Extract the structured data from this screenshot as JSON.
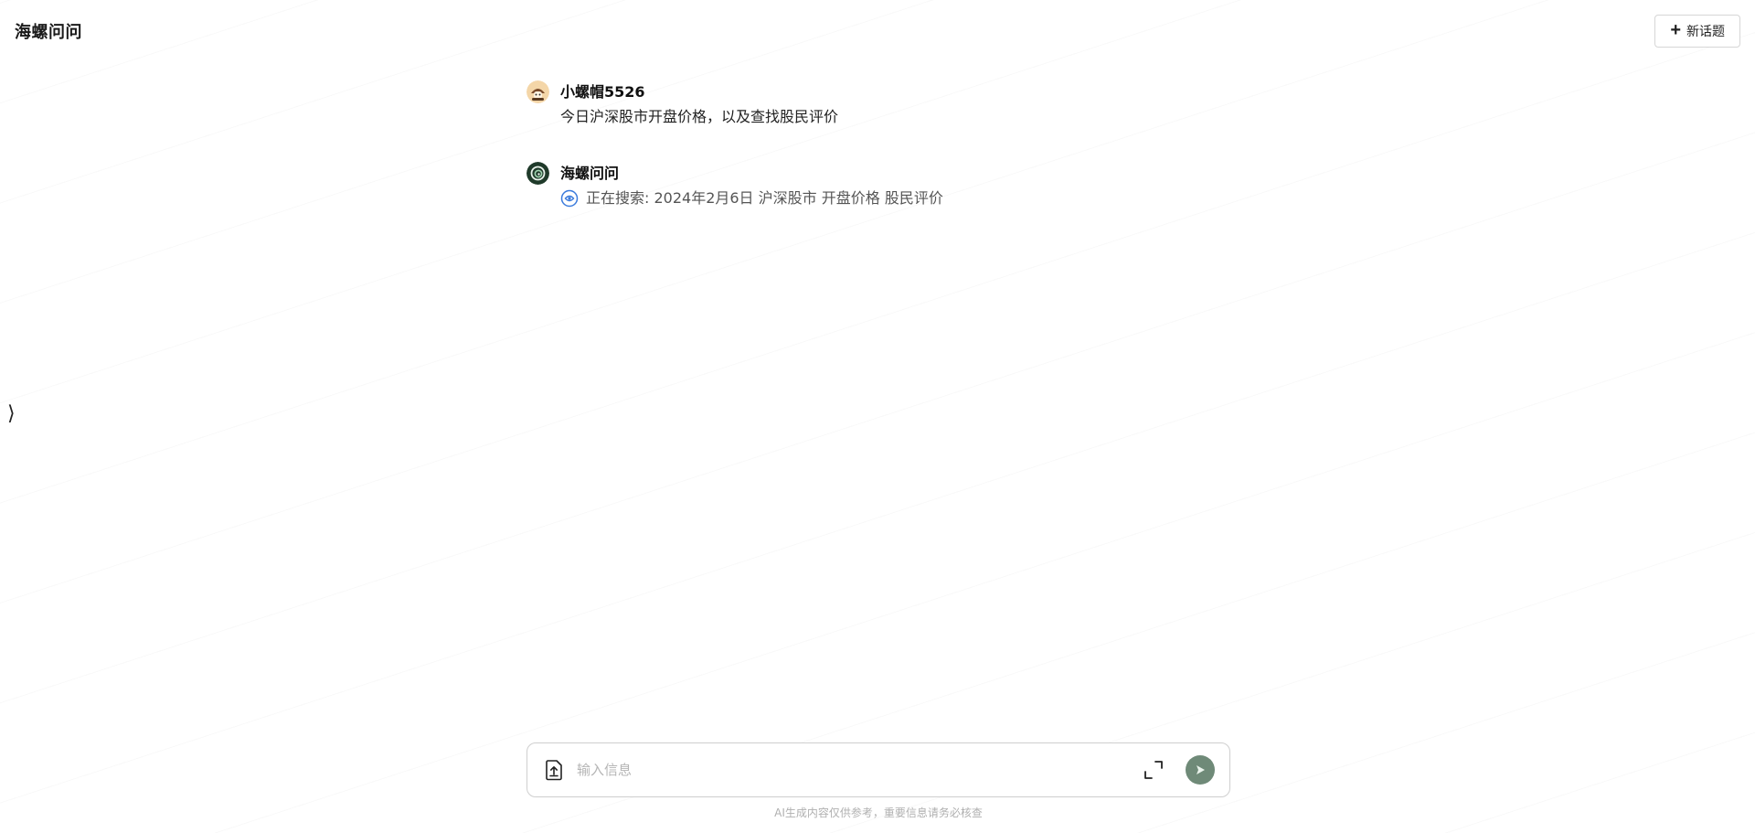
{
  "header": {
    "title": "海螺问问",
    "new_topic_label": "新话题"
  },
  "sidebar_toggle": "⟩",
  "messages": [
    {
      "author": "小螺帽5526",
      "text": "今日沪深股市开盘价格，以及查找股民评价"
    },
    {
      "author": "海螺问问",
      "search_status": "正在搜索: 2024年2月6日 沪深股市 开盘价格 股民评价"
    }
  ],
  "composer": {
    "placeholder": "输入信息"
  },
  "disclaimer": "AI生成内容仅供参考，重要信息请务必核查",
  "colors": {
    "send_button": "#6f8a78",
    "search_icon": "#3b7bdc",
    "assistant_avatar": "#1f3a2a"
  }
}
